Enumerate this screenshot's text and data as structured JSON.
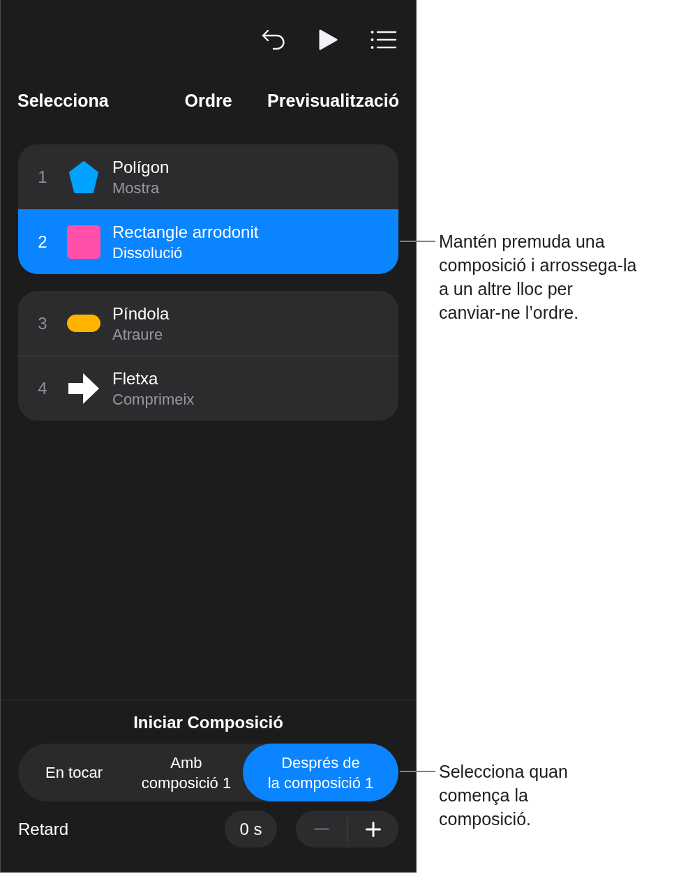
{
  "nav": {
    "left": "Selecciona",
    "title": "Ordre",
    "right": "Previsualització"
  },
  "groups": [
    {
      "items": [
        {
          "number": "1",
          "name": "Polígon",
          "effect": "Mostra",
          "kind": "pentagon",
          "color": "#00a2ff",
          "selected": false
        },
        {
          "number": "2",
          "name": "Rectangle arrodonit",
          "effect": "Dissolució",
          "kind": "square",
          "color": "#ff4fa8",
          "selected": true
        }
      ]
    },
    {
      "items": [
        {
          "number": "3",
          "name": "Píndola",
          "effect": "Atraure",
          "kind": "pill",
          "color": "#ffb400",
          "selected": false
        },
        {
          "number": "4",
          "name": "Fletxa",
          "effect": "Comprimeix",
          "kind": "arrow",
          "color": "#ffffff",
          "selected": false
        }
      ]
    }
  ],
  "start": {
    "title": "Iniciar Composició",
    "options": [
      {
        "label": "En tocar",
        "selected": false
      },
      {
        "label": "Amb\ncomposició 1",
        "selected": false
      },
      {
        "label": "Després de\nla composició 1",
        "selected": true
      }
    ]
  },
  "delay": {
    "label": "Retard",
    "value": "0 s",
    "decrement": {
      "disabled": true
    },
    "increment": {
      "disabled": false
    }
  },
  "callouts": [
    {
      "text": "Mantén premuda una\ncomposició i arrossega-la\na un altre lloc per\ncanviar-ne l’ordre."
    },
    {
      "text": "Selecciona quan\ncomença la\ncomposició."
    }
  ]
}
